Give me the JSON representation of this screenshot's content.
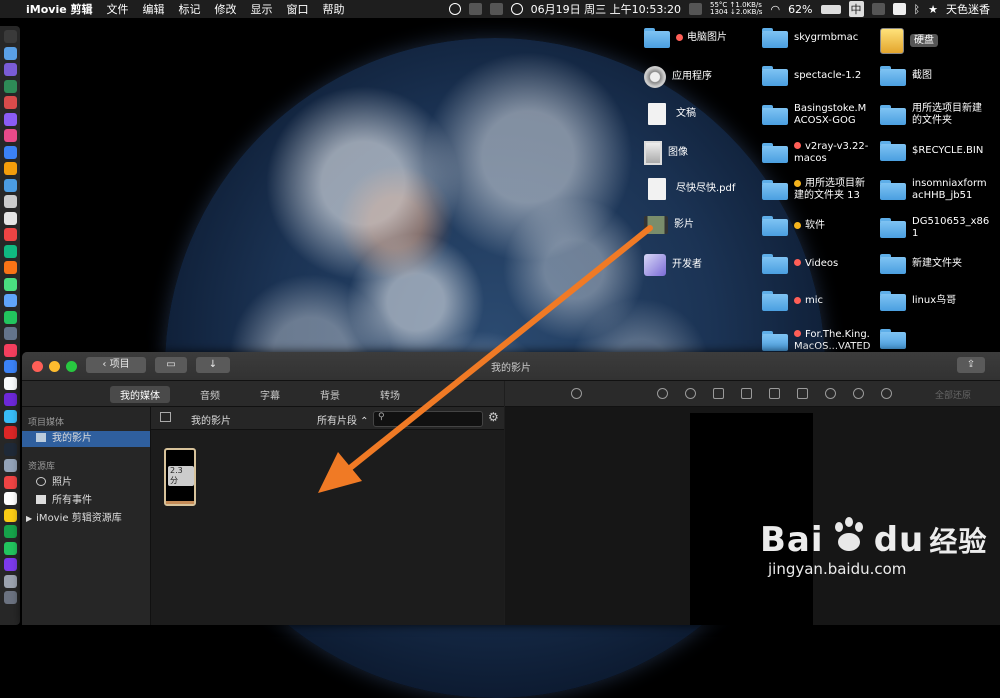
{
  "menubar": {
    "app_name": "iMovie 剪辑",
    "menus": [
      "文件",
      "编辑",
      "标记",
      "修改",
      "显示",
      "窗口",
      "帮助"
    ],
    "net_up": "55°C ↑1.0KB/s",
    "net_down": "1304 ↓2.0KB/s",
    "datetime": "06月19日 周三 上午10:53:20",
    "battery": "62%",
    "input_method": "中",
    "user": "天色迷香"
  },
  "desktop_col1": [
    {
      "label": "电脑图片",
      "dot": "#ff5f57"
    },
    {
      "label": "应用程序"
    },
    {
      "label": "文稿"
    },
    {
      "label": "图像"
    },
    {
      "label": "尽快尽快.pdf"
    },
    {
      "label": "影片"
    },
    {
      "label": "开发者"
    }
  ],
  "desktop_col2": [
    {
      "label": "skygrmbmac"
    },
    {
      "label": "spectacle-1.2"
    },
    {
      "label": "Basingstoke.M\nACOSX-GOG"
    },
    {
      "label": "v2ray-v3.22-\nmacos",
      "dot": "#ff5f57"
    },
    {
      "label": "用所选项目新\n建的文件夹 13",
      "dot": "#f5b41d"
    },
    {
      "label": "软件",
      "dot": "#f5b41d"
    },
    {
      "label": "Videos",
      "dot": "#ff5f57"
    },
    {
      "label": "mic",
      "dot": "#ff5f57"
    },
    {
      "label": "For.The.King.\nMacOS...VATED",
      "dot": "#ff5f57"
    }
  ],
  "desktop_col3": [
    {
      "label": "硬盘"
    },
    {
      "label": "截图"
    },
    {
      "label": "用所选项目新建\n的文件夹"
    },
    {
      "label": "$RECYCLE.BIN"
    },
    {
      "label": "insomniaxform\nacHHB_jb51"
    },
    {
      "label": "DG510653_x86\n1"
    },
    {
      "label": "新建文件夹"
    },
    {
      "label": "linux鸟哥"
    },
    {
      "label": ""
    }
  ],
  "window": {
    "title": "我的影片",
    "back_label": "项目",
    "tabs": [
      "我的媒体",
      "音频",
      "字幕",
      "背景",
      "转场"
    ],
    "active_tab": "我的媒体",
    "sidebar": {
      "project_media_header": "项目媒体",
      "my_movie": "我的影片",
      "library_header": "资源库",
      "photos": "照片",
      "all_events": "所有事件",
      "imovie_library": "iMovie 剪辑资源库"
    },
    "browser": {
      "title": "我的影片",
      "filter": "所有片段",
      "clip_duration": "2.3 分"
    },
    "reset_all": "全部还原"
  },
  "watermark": {
    "brand": "Bai",
    "brand2": "du",
    "suffix": "经验",
    "url": "jingyan.baidu.com"
  },
  "colors": {
    "arrow": "#f07a25",
    "selection": "#2f5f9e",
    "folder": "#5eaee8"
  }
}
